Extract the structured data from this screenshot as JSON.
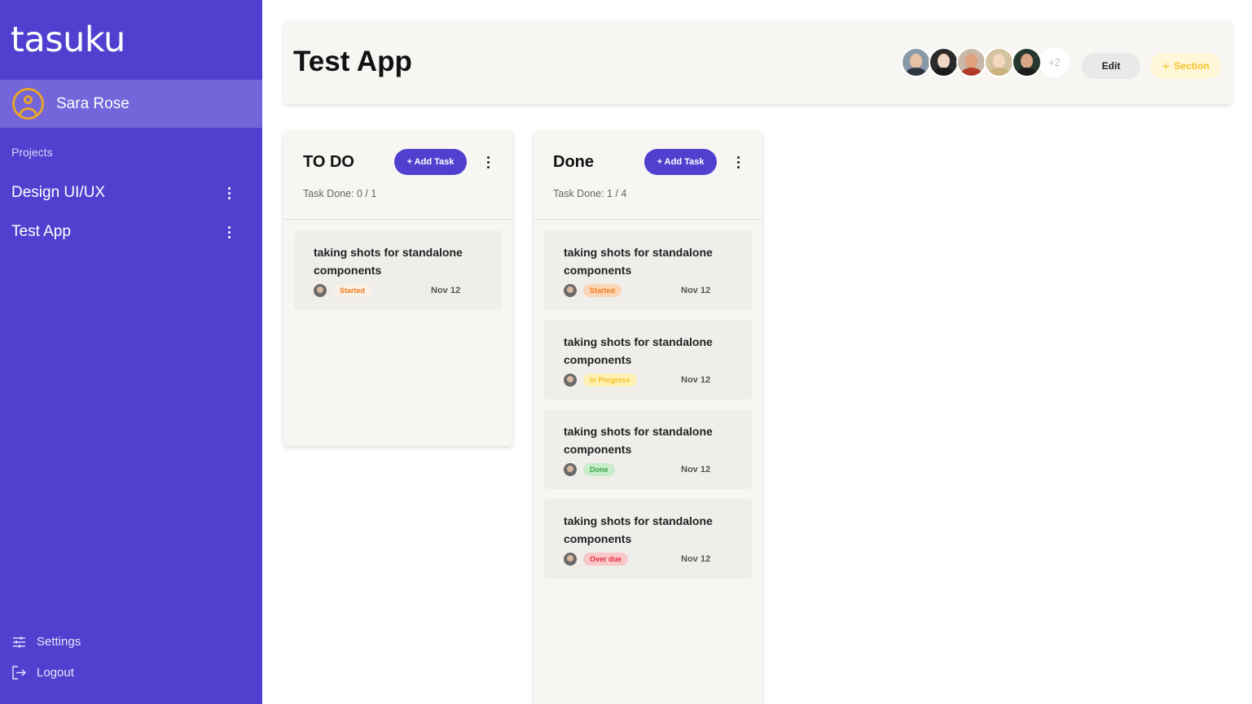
{
  "app": {
    "logo": "tasuku"
  },
  "user": {
    "name": "Sara Rose"
  },
  "sidebar": {
    "projects_label": "Projects",
    "projects": [
      {
        "label": "Design UI/UX"
      },
      {
        "label": "Test App"
      }
    ],
    "settings_label": "Settings",
    "logout_label": "Logout"
  },
  "header": {
    "title": "Test App",
    "members_more": "+2",
    "edit_label": "Edit",
    "section_label": "Section"
  },
  "columns": [
    {
      "title": "TO DO",
      "add_label": "+ Add Task",
      "count_label": "Task Done: 0 / 1",
      "tasks": [
        {
          "title": "taking shots for standalone components",
          "status": "Started",
          "date": "Nov 12"
        }
      ]
    },
    {
      "title": "Done",
      "add_label": "+ Add Task",
      "count_label": "Task Done: 1 / 4",
      "tasks": [
        {
          "title": "taking shots for standalone components",
          "status": "Started",
          "date": "Nov 12"
        },
        {
          "title": "taking shots for standalone components",
          "status": "In Progress",
          "date": "Nov 12"
        },
        {
          "title": "taking shots for standalone components",
          "status": "Done",
          "date": "Nov 12"
        },
        {
          "title": "taking shots for standalone components",
          "status": "Over due",
          "date": "Nov 12"
        }
      ]
    }
  ],
  "colors": {
    "brand": "#5140cf",
    "status_started_bg": "#fbd6b6",
    "status_started_fg": "#f07b1d",
    "status_progress_bg": "#fff0b3",
    "status_progress_fg": "#f5c32a",
    "status_done_bg": "#c9eccb",
    "status_done_fg": "#3aa447",
    "status_overdue_bg": "#f9c6c9",
    "status_overdue_fg": "#e2303c"
  }
}
